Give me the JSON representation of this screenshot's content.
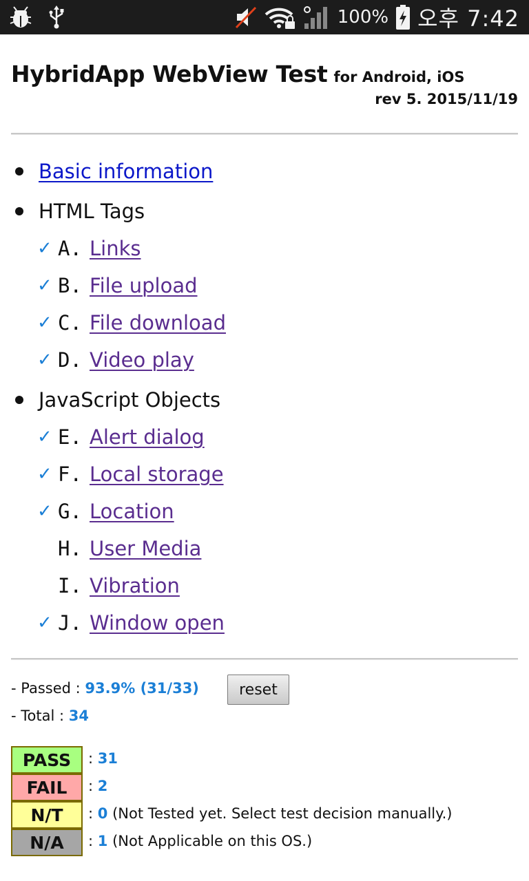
{
  "status_bar": {
    "battery": "100%",
    "time": "오후 7:42",
    "left_icons": [
      "bug-icon",
      "usb-icon"
    ],
    "right_icons": [
      "mute-icon",
      "wifi-lock-icon",
      "signal-icon",
      "battery-charging-icon"
    ]
  },
  "header": {
    "title": "HybridApp WebView Test",
    "subtitle": "for Android, iOS",
    "revision": "rev 5. 2015/11/19"
  },
  "list": {
    "basic_info": "Basic information",
    "sections": [
      {
        "label": "HTML Tags",
        "items": [
          {
            "letter": "A.",
            "label": "Links",
            "checked": true
          },
          {
            "letter": "B.",
            "label": "File upload",
            "checked": true
          },
          {
            "letter": "C.",
            "label": "File download",
            "checked": true
          },
          {
            "letter": "D.",
            "label": "Video play",
            "checked": true
          }
        ]
      },
      {
        "label": "JavaScript Objects",
        "items": [
          {
            "letter": "E.",
            "label": "Alert dialog",
            "checked": true
          },
          {
            "letter": "F.",
            "label": "Local storage",
            "checked": true
          },
          {
            "letter": "G.",
            "label": "Location",
            "checked": true
          },
          {
            "letter": "H.",
            "label": "User Media",
            "checked": false
          },
          {
            "letter": "I.",
            "label": "Vibration",
            "checked": false
          },
          {
            "letter": "J.",
            "label": "Window open",
            "checked": true
          }
        ]
      }
    ],
    "check_glyph": "✓"
  },
  "summary": {
    "passed_label": "- Passed :",
    "passed_value": "93.9% (31/33)",
    "total_label": "- Total :",
    "total_value": "34",
    "reset_label": "reset"
  },
  "legend": [
    {
      "badge": "PASS",
      "color": "#a8ff80",
      "count": "31",
      "note": ""
    },
    {
      "badge": "FAIL",
      "color": "#ffa8a8",
      "count": "2",
      "note": ""
    },
    {
      "badge": "N/T",
      "color": "#ffff99",
      "count": "0",
      "note": "(Not Tested yet. Select test decision manually.)"
    },
    {
      "badge": "N/A",
      "color": "#a6a6a6",
      "count": "1",
      "note": "(Not Applicable on this OS.)"
    }
  ],
  "colors": {
    "accent_blue": "#1b7fd6",
    "visited_link": "#5a2d8f",
    "link": "#0b17c9"
  }
}
